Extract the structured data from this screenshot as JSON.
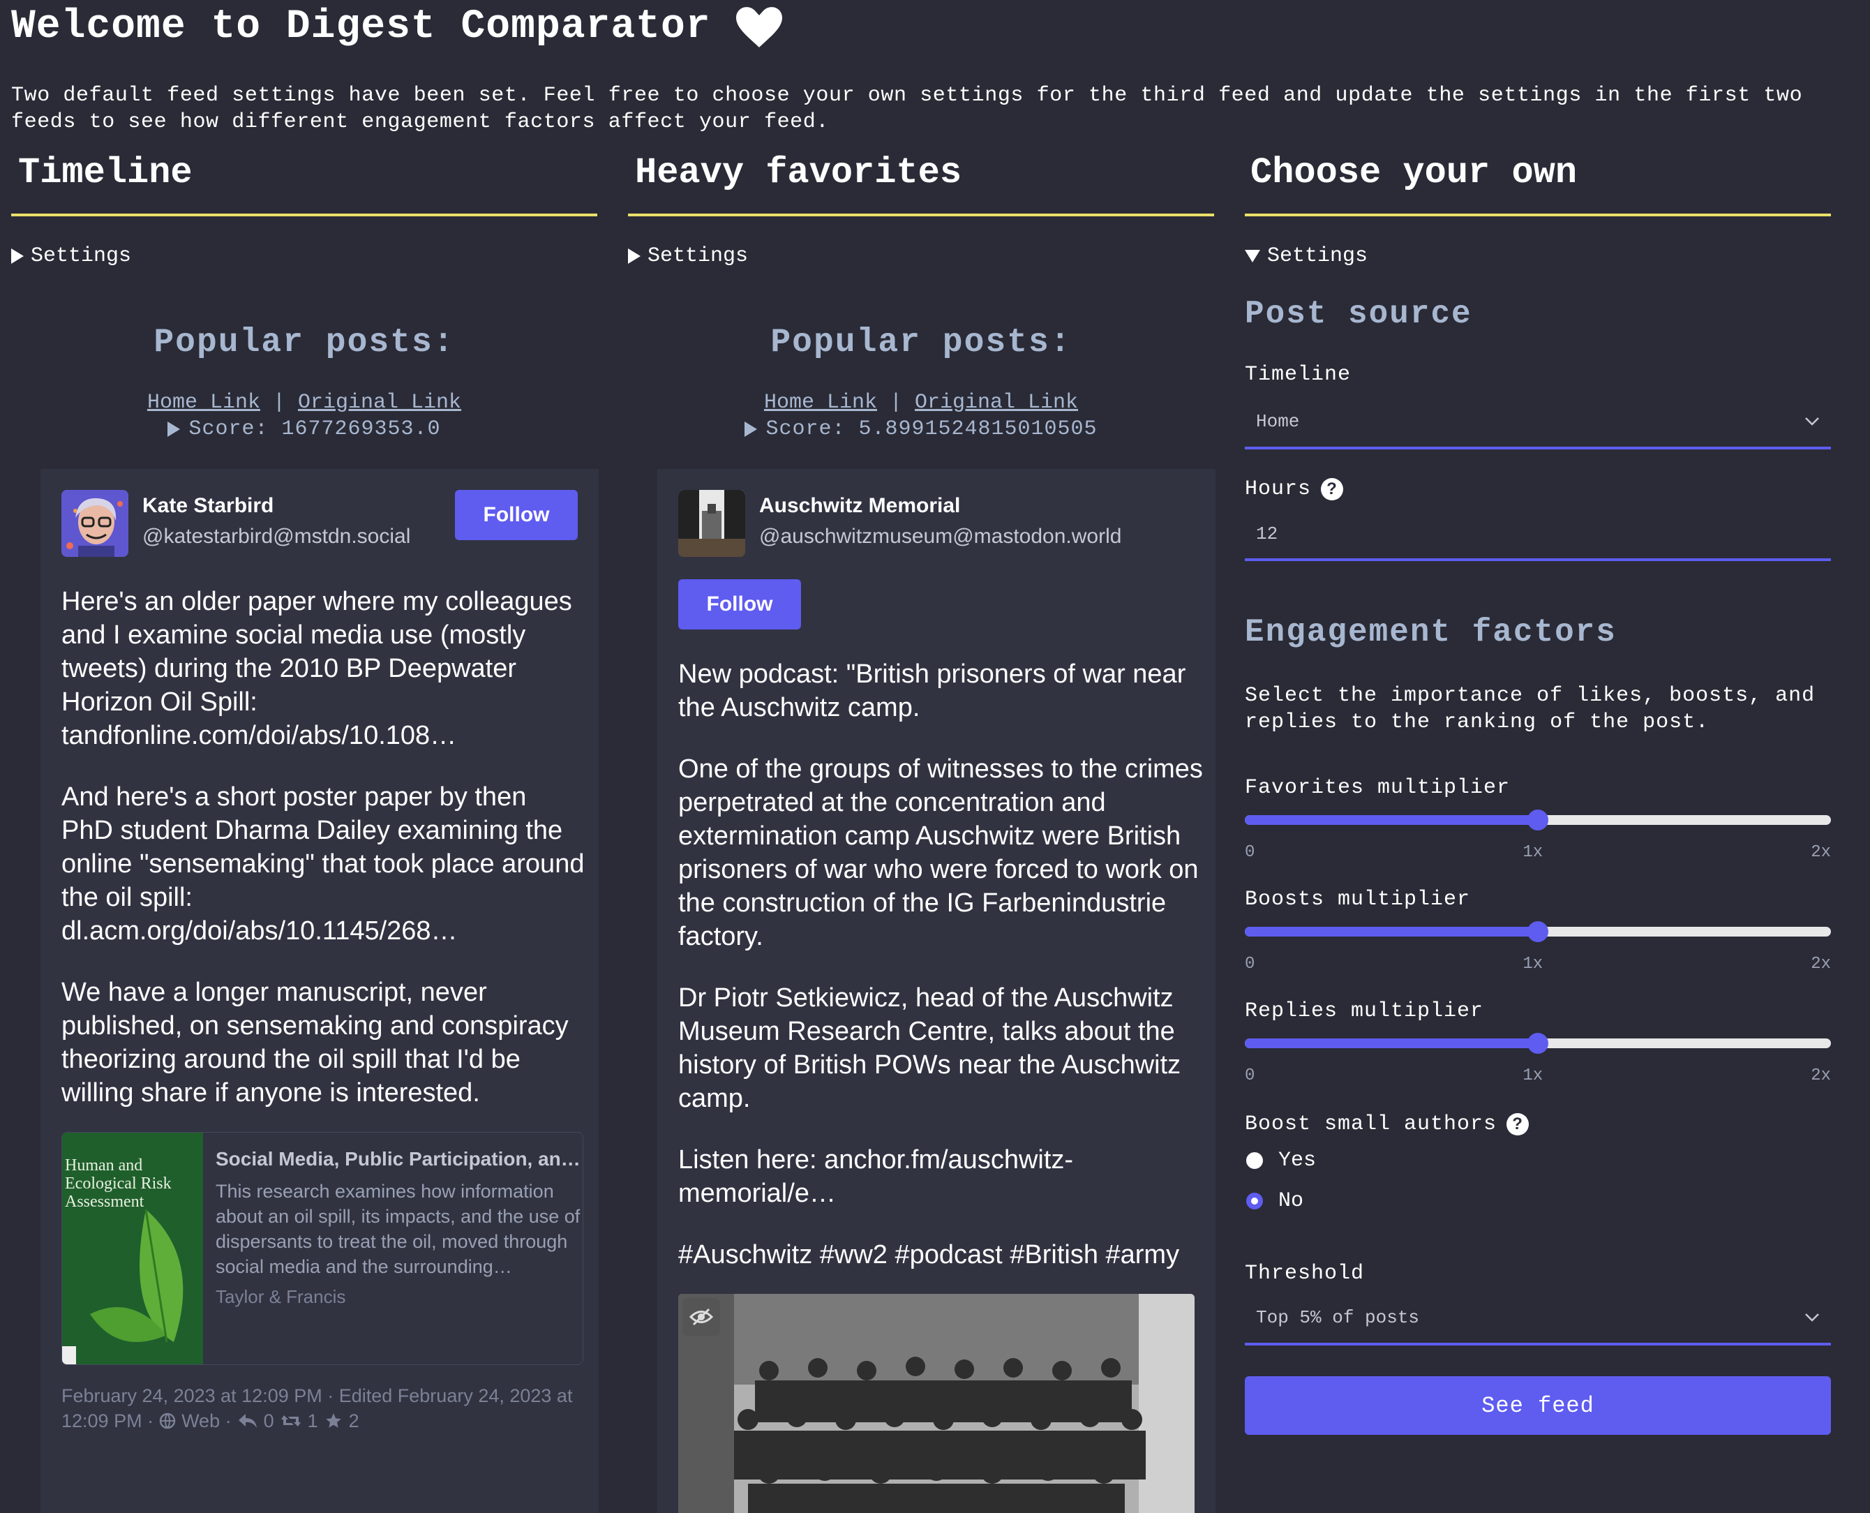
{
  "header": {
    "title": "Welcome to Digest Comparator",
    "intro": "Two default feed settings have been set. Feel free to choose your own settings for the third feed and update the settings in the first two feeds to see how different engagement factors affect your feed."
  },
  "columns": [
    {
      "title": "Timeline",
      "settings_label": "Settings",
      "popular_heading": "Popular posts:",
      "home_link": "Home Link",
      "separator": "|",
      "original_link": "Original Link",
      "score": "Score: 1677269353.0",
      "post": {
        "author_name": "Kate Starbird",
        "author_handle": "@katestarbird@mstdn.social",
        "follow_label": "Follow",
        "paragraphs": [
          "Here's an older paper where my colleagues and I examine social media use (mostly tweets) during the 2010 BP Deepwater Horizon Oil Spill: tandfonline.com/doi/abs/10.108…",
          "And here's a short poster paper by then PhD student Dharma Dailey examining the online \"sensemaking\" that took place around the oil spill: dl.acm.org/doi/abs/10.1145/268…",
          "We have a longer manuscript, never published, on sensemaking and conspiracy theorizing around the oil spill that I'd be willing share if anyone is interested."
        ],
        "preview": {
          "title": "Social Media, Public Participation, an…",
          "description": "This research examines how information about an oil spill, its impacts, and the use of dispersants to treat the oil, moved through social media and the surrounding…",
          "source": "Taylor & Francis",
          "cover_title": "Human and Ecological Risk Assessment"
        },
        "meta_line1": "February 24, 2023 at 12:09 PM · Edited February 24, 2023 at",
        "meta_time": "12:09 PM ·",
        "meta_web": "Web ·",
        "replies": "0",
        "boosts": "1",
        "favorites": "2"
      }
    },
    {
      "title": "Heavy favorites",
      "settings_label": "Settings",
      "popular_heading": "Popular posts:",
      "home_link": "Home Link",
      "separator": "|",
      "original_link": "Original Link",
      "score": "Score: 5.8991524815010505",
      "post": {
        "author_name": "Auschwitz Memorial",
        "author_handle": "@auschwitzmuseum@mastodon.world",
        "follow_label": "Follow",
        "paragraphs": [
          "New podcast: \"British prisoners of war near the Auschwitz camp.",
          "One of the groups of witnesses to the crimes perpetrated at the concentration and extermination camp Auschwitz were British prisoners of war who were forced to work on the construction of the IG Farbenindustrie factory.",
          "Dr Piotr Setkiewicz, head of the Auschwitz Museum Research Centre, talks about the history of British POWs near the Auschwitz camp.",
          "Listen here: anchor.fm/auschwitz-memorial/e…",
          "#Auschwitz #ww2 #podcast #British #army"
        ]
      }
    }
  ],
  "custom": {
    "title": "Choose your own",
    "settings_label": "Settings",
    "post_source_heading": "Post source",
    "timeline_label": "Timeline",
    "timeline_value": "Home",
    "hours_label": "Hours",
    "hours_value": "12",
    "help_glyph": "?",
    "engagement_heading": "Engagement factors",
    "engagement_desc": "Select the importance of likes, boosts, and replies to the ranking of the post.",
    "sliders": [
      {
        "label": "Favorites multiplier",
        "value": 1,
        "min_label": "0",
        "mid_label": "1x",
        "max_label": "2x"
      },
      {
        "label": "Boosts multiplier",
        "value": 1,
        "min_label": "0",
        "mid_label": "1x",
        "max_label": "2x"
      },
      {
        "label": "Replies multiplier",
        "value": 1,
        "min_label": "0",
        "mid_label": "1x",
        "max_label": "2x"
      }
    ],
    "boost_small_label": "Boost small authors",
    "option_yes": "Yes",
    "option_no": "No",
    "selected_option": "No",
    "threshold_label": "Threshold",
    "threshold_value": "Top 5% of posts",
    "see_feed_label": "See feed"
  },
  "colors": {
    "background": "#2a2b36",
    "card": "#313341",
    "accent": "#5f5cf0",
    "divider": "#e9e06a",
    "muted_heading": "#a8b7d0"
  }
}
